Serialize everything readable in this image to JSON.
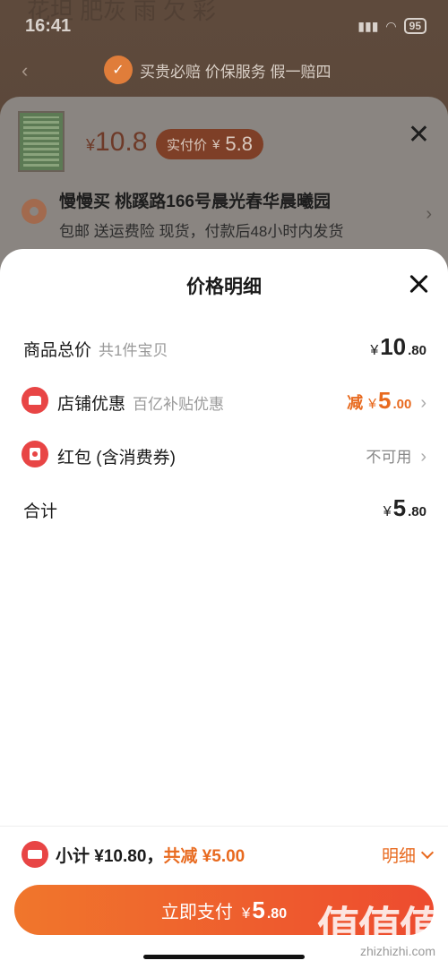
{
  "status_bar": {
    "time": "16:41",
    "battery": "95"
  },
  "background_title": "花坦 肥灰 雨 欠 彩",
  "guarantee": {
    "text": "买贵必赔 价保服务 假一赔四"
  },
  "product": {
    "yen": "¥",
    "price": "10.8",
    "real_price_label": "实付价",
    "real_price_yen": "¥",
    "real_price_value": "5.8"
  },
  "address": {
    "name": "慢慢买 桃蹊路166号晨光春华晨曦园",
    "sub": "包邮 送运费险 现货，付款后48小时内发货"
  },
  "modal": {
    "title": "价格明细",
    "rows": [
      {
        "label": "商品总价",
        "sub": "共1件宝贝",
        "yen": "¥",
        "int": "10",
        "dec": ".80"
      },
      {
        "label": "店铺优惠",
        "sub": "百亿补贴优惠",
        "minus": "减",
        "yen": "¥",
        "int": "5",
        "dec": ".00"
      },
      {
        "label": "红包 (含消费券)",
        "status": "不可用"
      },
      {
        "label": "合计",
        "yen": "¥",
        "int": "5",
        "dec": ".80"
      }
    ]
  },
  "bottom": {
    "subtotal": "小计 ¥10.80，",
    "discount": "共减 ¥5.00",
    "detail": "明细"
  },
  "pay_button": {
    "label": "立即支付",
    "yen": "¥",
    "int": "5",
    "dec": ".80"
  },
  "watermark": {
    "text": "值值值",
    "sub": "zhizhizhi.com"
  }
}
